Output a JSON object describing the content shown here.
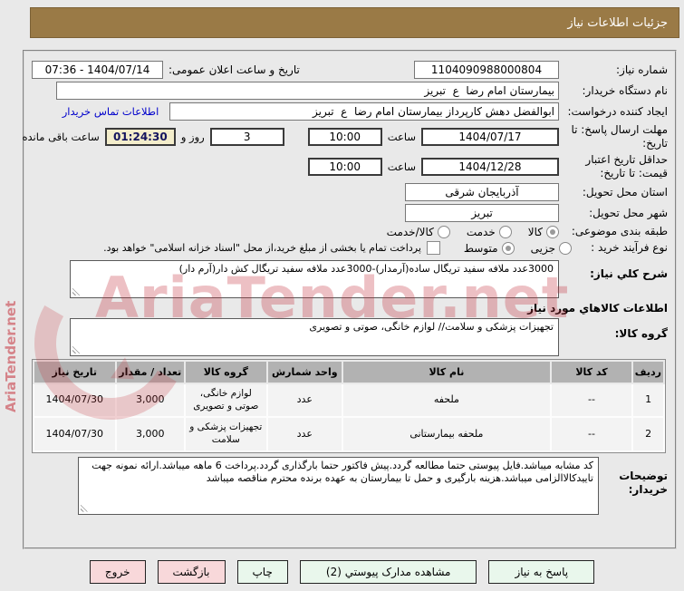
{
  "title_bar": {
    "text": "جزئیات اطلاعات نیاز"
  },
  "watermark": {
    "text": "AriaTender.net"
  },
  "form": {
    "need_number": {
      "label": "شماره نیاز:",
      "value": "1104090988000804"
    },
    "announce_datetime": {
      "label": "تاریخ و ساعت اعلان عمومی:",
      "value": "07:36 - 1404/07/14"
    },
    "buyer_org": {
      "label": "نام دستگاه خریدار:",
      "value": "بیمارستان امام رضا  ع  تبریز"
    },
    "request_creator": {
      "label": "ایجاد کننده درخواست:",
      "value": "ابوالفضل دهش کارپرداز بیمارستان امام رضا  ع  تبریز"
    },
    "buyer_contact_link": "اطلاعات تماس خریدار",
    "reply_deadline": {
      "label": "مهلت ارسال پاسخ: تا تاریخ:",
      "date": "1404/07/17",
      "hour_label": "ساعت",
      "time": "10:00"
    },
    "remaining": {
      "days": "3",
      "days_label": "روز و",
      "time": "01:24:30",
      "suffix": "ساعت باقی مانده"
    },
    "price_validity": {
      "label": "حداقل تاریخ اعتبار قیمت: تا تاریخ:",
      "date": "1404/12/28",
      "hour_label": "ساعت",
      "time": "10:00"
    },
    "province": {
      "label": "استان محل تحویل:",
      "value": "آذربایجان شرقی"
    },
    "city": {
      "label": "شهر محل تحویل:",
      "value": "تبریز"
    },
    "subject_class": {
      "label": "طبقه بندی موضوعی:",
      "options": [
        {
          "label": "کالا",
          "selected": true
        },
        {
          "label": "خدمت",
          "selected": false
        },
        {
          "label": "کالا/خدمت",
          "selected": false
        }
      ]
    },
    "process_type": {
      "label": "نوع فرآیند خرید :",
      "options": [
        {
          "label": "جزیی",
          "selected": false
        },
        {
          "label": "متوسط",
          "selected": true
        }
      ]
    },
    "treasury_checkbox": {
      "checked": false,
      "label": "پرداخت تمام یا بخشی از مبلغ خرید،از محل \"اسناد خزانه اسلامی\" خواهد بود."
    },
    "need_desc": {
      "label": "شرح کلي نیاز:",
      "value": "3000عدد ملافه سفید تریگال ساده(آرمدار)-3000عدد ملافه سفید تریگال کش دار(آرم دار)"
    },
    "goods_section_title": "اطلاعات کالاهاي مورد نیاز",
    "goods_group": {
      "label": "گروه کالا:",
      "value": "تجهیزات پزشکی و سلامت// لوازم خانگی، صوتی و تصویری"
    },
    "buyer_notes": {
      "label": "توضیحات خریدار:",
      "value": "کد مشابه میباشد.فایل پیوستی حتما مطالعه گردد.پیش فاکتور حتما بارگذاری گردد.پرداخت 6 ماهه میباشد.ارائه نمونه جهت تاییدکالاالزامی میباشد.هزینه بارگیری و حمل تا بیمارستان به عهده برنده محترم مناقصه میباشد"
    }
  },
  "table": {
    "headers": [
      "ردیف",
      "کد کالا",
      "نام کالا",
      "واحد شمارش",
      "گروه کالا",
      "تعداد / مقدار",
      "تاریخ نیاز"
    ],
    "rows": [
      [
        "1",
        "--",
        "ملحفه",
        "عدد",
        "لوازم خانگی، صوتی و تصویری",
        "3,000",
        "1404/07/30"
      ],
      [
        "2",
        "--",
        "ملحفه بیمارستانی",
        "عدد",
        "تجهیزات پزشکی و سلامت",
        "3,000",
        "1404/07/30"
      ]
    ]
  },
  "buttons": [
    {
      "label": "پاسخ به نیاز",
      "type": "green"
    },
    {
      "label": "مشاهده مدارک پیوستي (2)",
      "type": "green"
    },
    {
      "label": "چاپ",
      "type": "green"
    },
    {
      "label": "بازگشت",
      "type": "pink"
    },
    {
      "label": "خروج",
      "type": "pink"
    }
  ],
  "colors": {
    "titlebar": "#9a7a46",
    "link": "#0000cc",
    "countdown_bg": "#f3edcb",
    "button_green": "#e9f7ec",
    "button_pink": "#f8d8da",
    "table_header": "#b2b2b2",
    "watermark": "#c4303a"
  }
}
